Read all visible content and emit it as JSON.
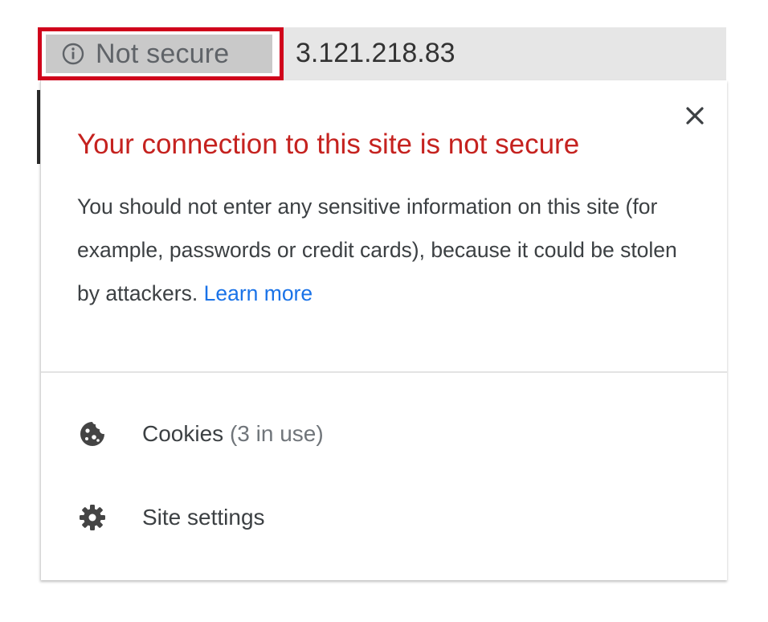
{
  "address_bar": {
    "security_label": "Not secure",
    "url": "3.121.218.83",
    "highlight_color": "#d0021b"
  },
  "popup": {
    "title": "Your connection to this site is not secure",
    "body": "You should not enter any sensitive information on this site (for example, passwords or credit cards), because it could be stolen by attackers.",
    "learn_more": "Learn more",
    "title_color": "#c5221f",
    "link_color": "#1a73e8",
    "items": [
      {
        "label": "Cookies",
        "detail": "(3 in use)",
        "icon": "cookie-icon"
      },
      {
        "label": "Site settings",
        "icon": "gear-icon"
      }
    ]
  }
}
